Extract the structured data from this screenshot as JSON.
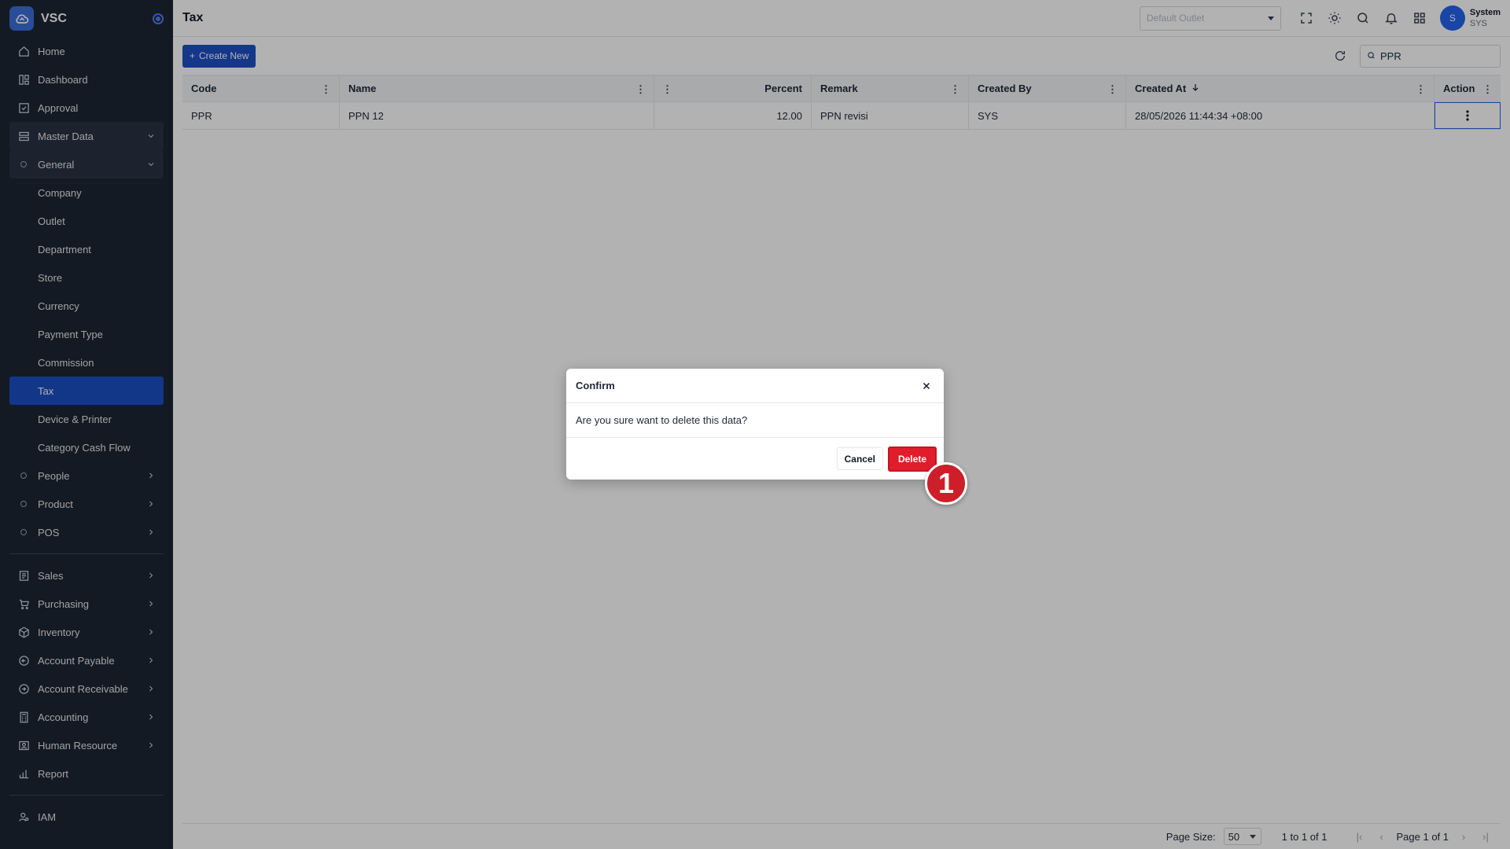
{
  "app": {
    "name": "VSC"
  },
  "sidebar": {
    "top_items": [
      {
        "label": "Home",
        "icon": "home-icon"
      },
      {
        "label": "Dashboard",
        "icon": "dashboard-icon"
      },
      {
        "label": "Approval",
        "icon": "approval-icon"
      },
      {
        "label": "Master Data",
        "icon": "database-icon"
      }
    ],
    "general": {
      "label": "General",
      "children": [
        "Company",
        "Outlet",
        "Department",
        "Store",
        "Currency",
        "Payment Type",
        "Commission",
        "Tax",
        "Device & Printer",
        "Category Cash Flow"
      ]
    },
    "groups": [
      "People",
      "Product",
      "POS"
    ],
    "modules": [
      {
        "label": "Sales",
        "icon": "sales-icon"
      },
      {
        "label": "Purchasing",
        "icon": "cart-icon"
      },
      {
        "label": "Inventory",
        "icon": "box-icon"
      },
      {
        "label": "Account Payable",
        "icon": "payable-icon"
      },
      {
        "label": "Account Receivable",
        "icon": "receivable-icon"
      },
      {
        "label": "Accounting",
        "icon": "calculator-icon"
      },
      {
        "label": "Human Resource",
        "icon": "person-card-icon"
      },
      {
        "label": "Report",
        "icon": "chart-icon"
      }
    ],
    "bottom": {
      "label": "IAM",
      "icon": "iam-icon"
    }
  },
  "topbar": {
    "title": "Tax",
    "outlet_placeholder": "Default Outlet",
    "user_initial": "S",
    "user_name": "System",
    "user_role": "SYS"
  },
  "toolbar": {
    "create_label": "Create New",
    "search_value": "PPR"
  },
  "table": {
    "columns": [
      "Code",
      "Name",
      "Percent",
      "Remark",
      "Created By",
      "Created At",
      "Action"
    ],
    "rows": [
      {
        "code": "PPR",
        "name": "PPN 12",
        "percent": "12.00",
        "remark": "PPN revisi",
        "created_by": "SYS",
        "created_at": "28/05/2026 11:44:34 +08:00"
      }
    ]
  },
  "footer": {
    "page_size_label": "Page Size:",
    "page_size": "50",
    "range": "1 to 1 of 1",
    "page_info": "Page 1 of 1"
  },
  "dialog": {
    "title": "Confirm",
    "message": "Are you sure want to delete this data?",
    "cancel_label": "Cancel",
    "delete_label": "Delete"
  },
  "annotation": {
    "step": "1"
  },
  "colors": {
    "accent": "#1d4fc4",
    "danger": "#e11d2b",
    "sidebar_bg": "#1e2633"
  }
}
